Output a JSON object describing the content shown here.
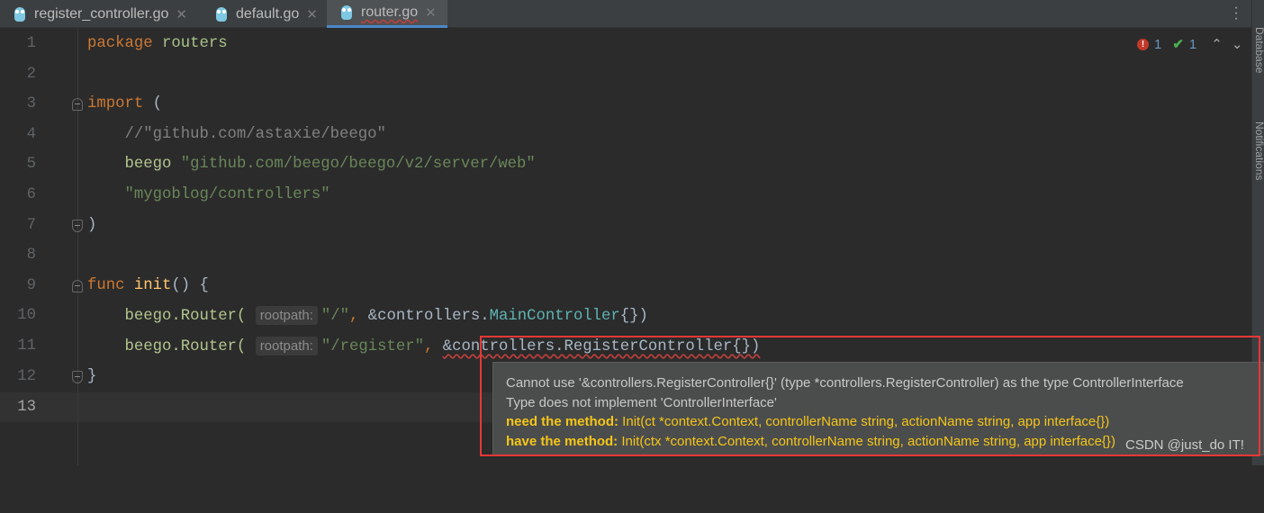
{
  "tabs": [
    {
      "label": "register_controller.go",
      "active": false
    },
    {
      "label": "default.go",
      "active": false
    },
    {
      "label": "router.go",
      "active": true
    }
  ],
  "right_sidebar": {
    "items": [
      "Database",
      "Notifications"
    ]
  },
  "inspection": {
    "errors": "1",
    "warnings": "1"
  },
  "editor": {
    "lines": [
      {
        "n": "1"
      },
      {
        "n": "2"
      },
      {
        "n": "3"
      },
      {
        "n": "4"
      },
      {
        "n": "5"
      },
      {
        "n": "6"
      },
      {
        "n": "7"
      },
      {
        "n": "8"
      },
      {
        "n": "9"
      },
      {
        "n": "10"
      },
      {
        "n": "11"
      },
      {
        "n": "12"
      },
      {
        "n": "13"
      }
    ],
    "tokens": {
      "package": "package",
      "routers": "routers",
      "import": "import",
      "lparen": "(",
      "rparen": ")",
      "comment": "//\"github.com/astaxie/beego\"",
      "beego": "beego",
      "beego_path": "\"github.com/beego/beego/v2/server/web\"",
      "controllers_path": "\"mygoblog/controllers\"",
      "func": "func",
      "init": "init",
      "init_rest": "() {",
      "router_call": "beego.Router(",
      "hint": "rootpath:",
      "root": "\"/\"",
      "register": "\"/register\"",
      "comma": ", ",
      "amp_ctrl": "&controllers.",
      "main_ctrl": "MainController",
      "register_ctrl": "&controllers.RegisterController{})",
      "close_call": "{})",
      "rbrace": "}"
    }
  },
  "tooltip": {
    "line1": "Cannot use '&controllers.RegisterController{}' (type *controllers.RegisterController) as the type ControllerInterface",
    "line2": "Type does not implement 'ControllerInterface'",
    "need_label": "need the method:",
    "need_sig": " Init(ct *context.Context, controllerName string, actionName string, app interface{})",
    "have_label": "have the method:",
    "have_sig": " Init(ctx *context.Context, controllerName string, actionName string, app interface{})"
  },
  "watermark": "CSDN @just_do IT!",
  "colors": {
    "keyword": "#cc7832",
    "string": "#6a8759",
    "highlight_box": "#e53935",
    "warning_text": "#f5c518"
  }
}
